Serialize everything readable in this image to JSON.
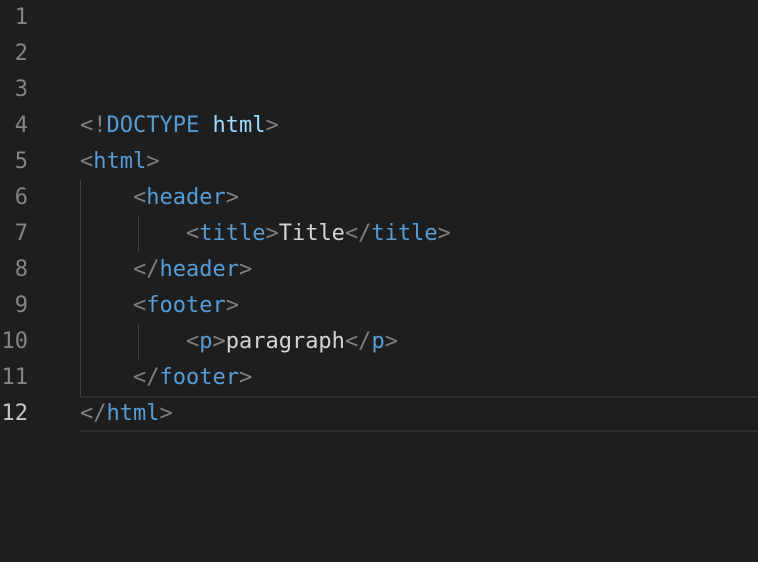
{
  "editor": {
    "current_line": 12,
    "lines": [
      {
        "n": "1",
        "tokens": []
      },
      {
        "n": "2",
        "tokens": []
      },
      {
        "n": "3",
        "tokens": []
      },
      {
        "n": "4",
        "tokens": [
          [
            "p",
            "<!"
          ],
          [
            "t",
            "DOCTYPE"
          ],
          [
            "txt",
            " "
          ],
          [
            "a",
            "html"
          ],
          [
            "p",
            ">"
          ]
        ]
      },
      {
        "n": "5",
        "tokens": [
          [
            "p",
            "<"
          ],
          [
            "t",
            "html"
          ],
          [
            "p",
            ">"
          ]
        ]
      },
      {
        "n": "6",
        "tokens": [
          [
            "txt",
            "    "
          ],
          [
            "p",
            "<"
          ],
          [
            "t",
            "header"
          ],
          [
            "p",
            ">"
          ]
        ]
      },
      {
        "n": "7",
        "tokens": [
          [
            "txt",
            "        "
          ],
          [
            "p",
            "<"
          ],
          [
            "t",
            "title"
          ],
          [
            "p",
            ">"
          ],
          [
            "txt",
            "Title"
          ],
          [
            "p",
            "</"
          ],
          [
            "t",
            "title"
          ],
          [
            "p",
            ">"
          ]
        ]
      },
      {
        "n": "8",
        "tokens": [
          [
            "txt",
            "    "
          ],
          [
            "p",
            "</"
          ],
          [
            "t",
            "header"
          ],
          [
            "p",
            ">"
          ]
        ]
      },
      {
        "n": "9",
        "tokens": [
          [
            "txt",
            "    "
          ],
          [
            "p",
            "<"
          ],
          [
            "t",
            "footer"
          ],
          [
            "p",
            ">"
          ]
        ]
      },
      {
        "n": "10",
        "tokens": [
          [
            "txt",
            "        "
          ],
          [
            "p",
            "<"
          ],
          [
            "t",
            "p"
          ],
          [
            "p",
            ">"
          ],
          [
            "txt",
            "paragraph"
          ],
          [
            "p",
            "</"
          ],
          [
            "t",
            "p"
          ],
          [
            "p",
            ">"
          ]
        ]
      },
      {
        "n": "11",
        "tokens": [
          [
            "txt",
            "    "
          ],
          [
            "p",
            "</"
          ],
          [
            "t",
            "footer"
          ],
          [
            "p",
            ">"
          ]
        ]
      },
      {
        "n": "12",
        "tokens": [
          [
            "p",
            "</"
          ],
          [
            "t",
            "html"
          ],
          [
            "p",
            ">"
          ]
        ]
      }
    ]
  },
  "colors": {
    "background": "#1e1e1e",
    "punctuation": "#808080",
    "tag": "#569cd6",
    "attribute": "#9cdcfe",
    "text": "#d4d4d4",
    "line_number": "#858585",
    "line_number_active": "#c6c6c6"
  }
}
